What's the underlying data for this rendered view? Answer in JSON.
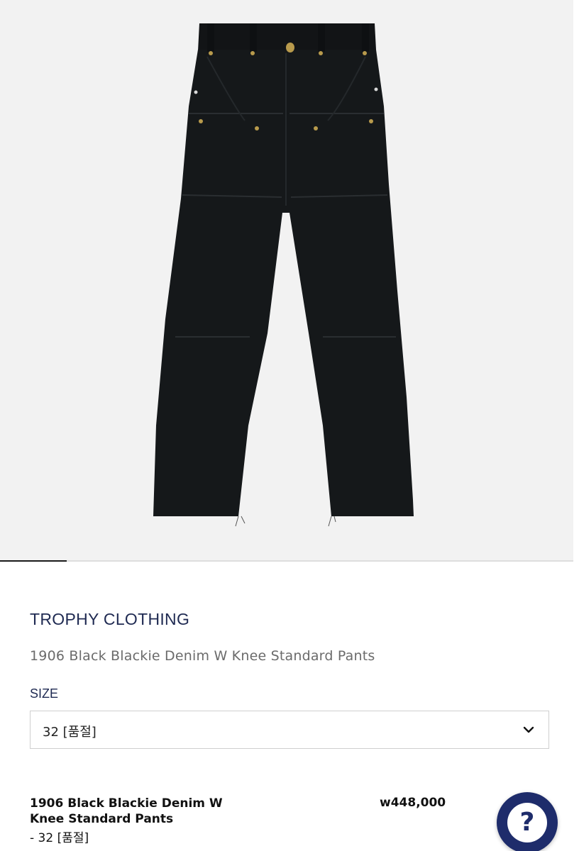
{
  "product": {
    "brand": "TROPHY CLOTHING",
    "name": "1906 Black Blackie Denim W Knee Standard Pants",
    "image_alt": "black double-knee denim pants"
  },
  "size_selector": {
    "label": "SIZE",
    "selected": "32 [품절]"
  },
  "selection_summary": {
    "name": "1906 Black Blackie Denim W Knee Standard Pants",
    "option": "- 32 [품절]",
    "price": "w448,000"
  },
  "help_button": {
    "glyph": "?"
  },
  "colors": {
    "brand_navy": "#1f2a52",
    "help_navy": "#1e2c6b",
    "photo_background": "#f2f2f2",
    "pants": "#15181a"
  },
  "carousel": {
    "active_index": 1,
    "total": 9
  }
}
